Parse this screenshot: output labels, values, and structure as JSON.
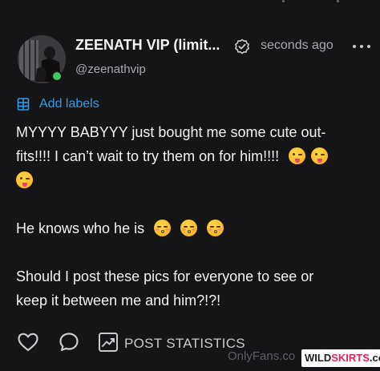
{
  "post": {
    "author_name": "ZEENATH VIP (limit...",
    "author_handle": "@zeenathvip",
    "timestamp": "seconds ago",
    "add_labels": "Add labels",
    "line1": "MYYYY BABYYY just bought me some cute out-",
    "line2": "fits!!!! I can’t wait to try them on for him!!!!",
    "line3": "He knows who he is",
    "line4": "Should I post these pics for everyone to see or",
    "line5": "keep it between me and him?!?!"
  },
  "actions": {
    "post_statistics": "POST STATISTICS"
  },
  "watermark": {
    "source": "OnlyFans.co",
    "site_a": "WILD",
    "site_b": "SKIRTS",
    "site_c": ".com"
  },
  "icons": {
    "verified": "verified-check-icon",
    "more": "more-dots-icon",
    "labels": "label-icon",
    "like": "heart-icon",
    "comment": "comment-bubble-icon",
    "stats": "chart-trend-icon"
  },
  "colors": {
    "background": "#151518",
    "accent": "#2f9be6",
    "online": "#3cc864",
    "text": "#f2f2f4",
    "muted": "#a7a7b0"
  }
}
